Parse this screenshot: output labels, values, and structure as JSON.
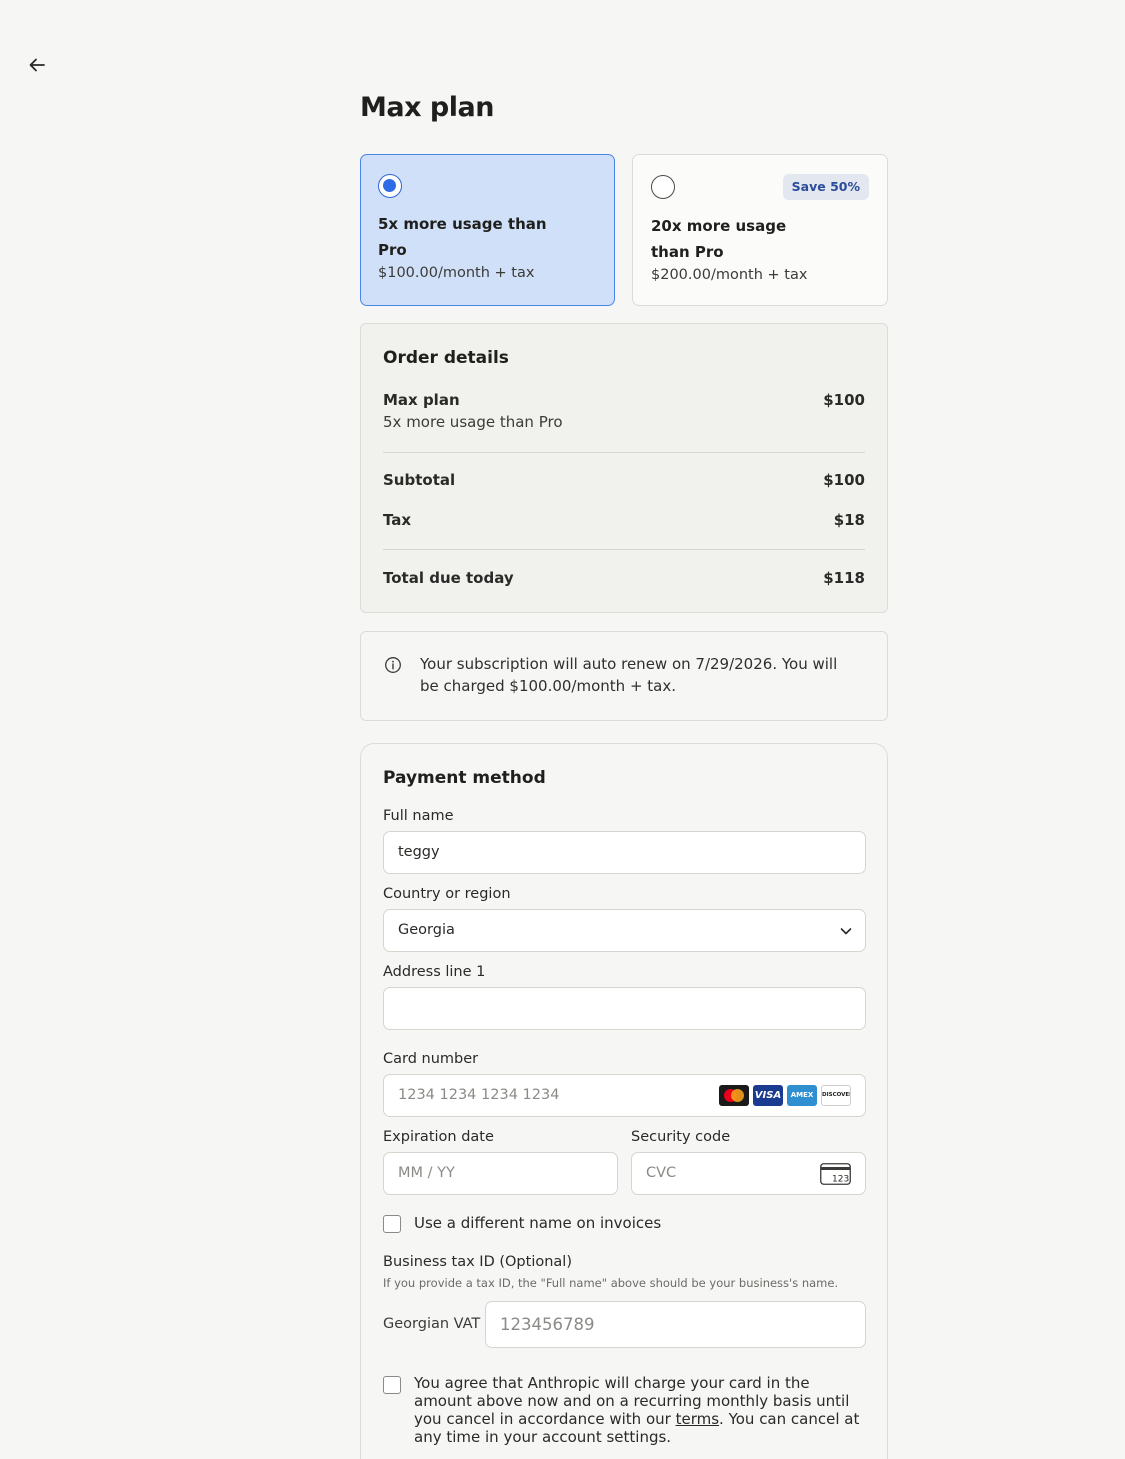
{
  "page": {
    "title": "Max plan"
  },
  "plans": [
    {
      "name": "5x more usage than Pro",
      "price": "$100.00/month + tax",
      "selected": true,
      "badge": ""
    },
    {
      "name": "20x more usage than Pro",
      "price": "$200.00/month + tax",
      "selected": false,
      "badge": "Save 50%"
    }
  ],
  "order": {
    "title": "Order details",
    "item_name": "Max plan",
    "item_desc": "5x more usage than Pro",
    "item_price": "$100",
    "subtotal_label": "Subtotal",
    "subtotal_value": "$100",
    "tax_label": "Tax",
    "tax_value": "$18",
    "total_label": "Total due today",
    "total_value": "$118"
  },
  "notice": {
    "text": "Your subscription will auto renew on 7/29/2026. You will be charged $100.00/month + tax."
  },
  "payment": {
    "title": "Payment method",
    "full_name_label": "Full name",
    "full_name_value": "teggy",
    "country_label": "Country or region",
    "country_value": "Georgia",
    "address_label": "Address line 1",
    "address_value": "",
    "card_label": "Card number",
    "card_placeholder": "1234 1234 1234 1234",
    "card_brands": [
      "mastercard",
      "visa",
      "amex",
      "discover"
    ],
    "card_brand_texts": {
      "visa": "VISA",
      "amex": "AMEX",
      "discover": "DISCOVER"
    },
    "exp_label": "Expiration date",
    "exp_placeholder": "MM / YY",
    "cvc_label": "Security code",
    "cvc_placeholder": "CVC",
    "cvc_icon_text": "123",
    "diff_name_label": "Use a different name on invoices",
    "tax_id_label": "Business tax ID (Optional)",
    "tax_id_hint": "If you provide a tax ID, the \"Full name\" above should be your business's name.",
    "vat_label": "Georgian VAT",
    "vat_placeholder": "123456789",
    "agree_pre": "You agree that Anthropic will charge your card in the amount above now and on a recurring monthly basis until you cancel in accordance with our ",
    "agree_link": "terms",
    "agree_post": ". You can cancel at any time in your account settings."
  },
  "colors": {
    "accent": "#2e6be6",
    "selected_bg": "#cfe0f8",
    "badge_bg": "#e3e7f0",
    "badge_text": "#2b4c9a"
  },
  "icons": {
    "back": "arrow-left-icon",
    "info": "info-icon",
    "chevron": "chevron-down-icon",
    "cvc": "card-cvc-icon"
  }
}
